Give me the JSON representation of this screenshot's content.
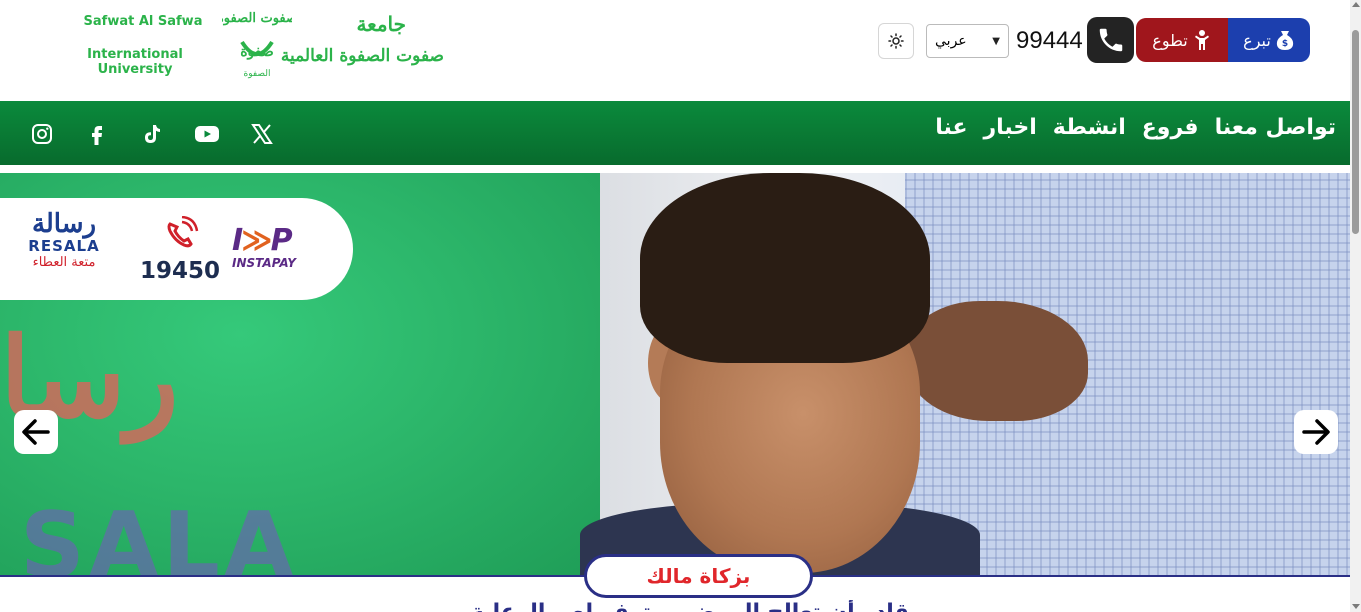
{
  "header": {
    "logo": {
      "name_en_line1": "Safwat Al Safwa",
      "name_en_line2": "International University",
      "name_ar_line1": "جامعة",
      "name_ar_line2": "صفوت الصفوة العالمية",
      "brand_color": "#2bb34a"
    },
    "theme_toggle_icon": "sun-icon",
    "language": {
      "selected": "عربي"
    },
    "phone": {
      "number": "99444",
      "icon": "phone-icon"
    },
    "volunteer_button": {
      "label": "تطوع",
      "icon": "volunteer-icon",
      "color": "#a0161c"
    },
    "donate_button": {
      "label": "تبرع",
      "icon": "money-bag-icon",
      "color": "#1c3fae"
    }
  },
  "nav": {
    "links": [
      "تواصل معنا",
      "فروع",
      "انشطة",
      "اخبار",
      "عنا"
    ],
    "socials": [
      "instagram-icon",
      "facebook-icon",
      "tiktok-icon",
      "youtube-icon",
      "x-icon"
    ],
    "color": "#0b8a3c"
  },
  "hero": {
    "sponsor": {
      "resala_ar": "رسالة",
      "resala_en": "RESALA",
      "resala_tagline": "متعة العطاء",
      "hotline": "19450",
      "instapay": "INSTAPAY"
    },
    "badge_label": "بزكاة مالك",
    "accent_color": "#2a2f86",
    "badge_text_color": "#e0262b"
  },
  "below": {
    "heading_partial": "قادر أن تعالج المرضى وتوفر لهم الرعاية"
  }
}
